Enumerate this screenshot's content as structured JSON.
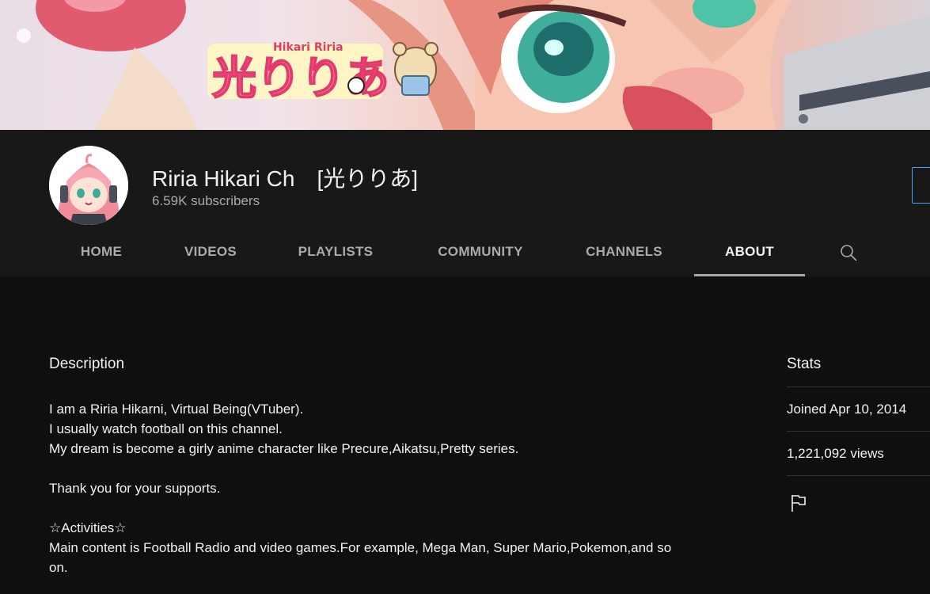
{
  "banner": {
    "logo_text": "光りりあ",
    "logo_subtext": "Hikari Riria"
  },
  "channel": {
    "name": "Riria Hikari Ch　[光りりあ]",
    "subscribers": "6.59K subscribers"
  },
  "tabs": [
    {
      "label": "HOME"
    },
    {
      "label": "VIDEOS"
    },
    {
      "label": "PLAYLISTS"
    },
    {
      "label": "COMMUNITY"
    },
    {
      "label": "CHANNELS"
    },
    {
      "label": "ABOUT"
    }
  ],
  "active_tab": "ABOUT",
  "about": {
    "description_title": "Description",
    "description_lines": [
      "I am a Riria Hikarni, Virtual Being(VTuber).",
      "I usually watch football on this channel.",
      "My dream is become a girly anime character like Precure,Aikatsu,Pretty series.",
      "",
      "Thank you for your supports.",
      "",
      "☆Activities☆",
      "Main content is Football Radio and video games.For example, Mega Man, Super Mario,Pokemon,and so on."
    ],
    "stats_title": "Stats",
    "joined": "Joined Apr 10, 2014",
    "views": "1,221,092 views"
  },
  "icons": {
    "search": "search-icon",
    "flag": "flag-icon"
  },
  "colors": {
    "background": "#0f0f0f",
    "header_background": "#181818",
    "secondary_text": "#aaaaaa",
    "accent_blue": "#3ea6ff"
  }
}
